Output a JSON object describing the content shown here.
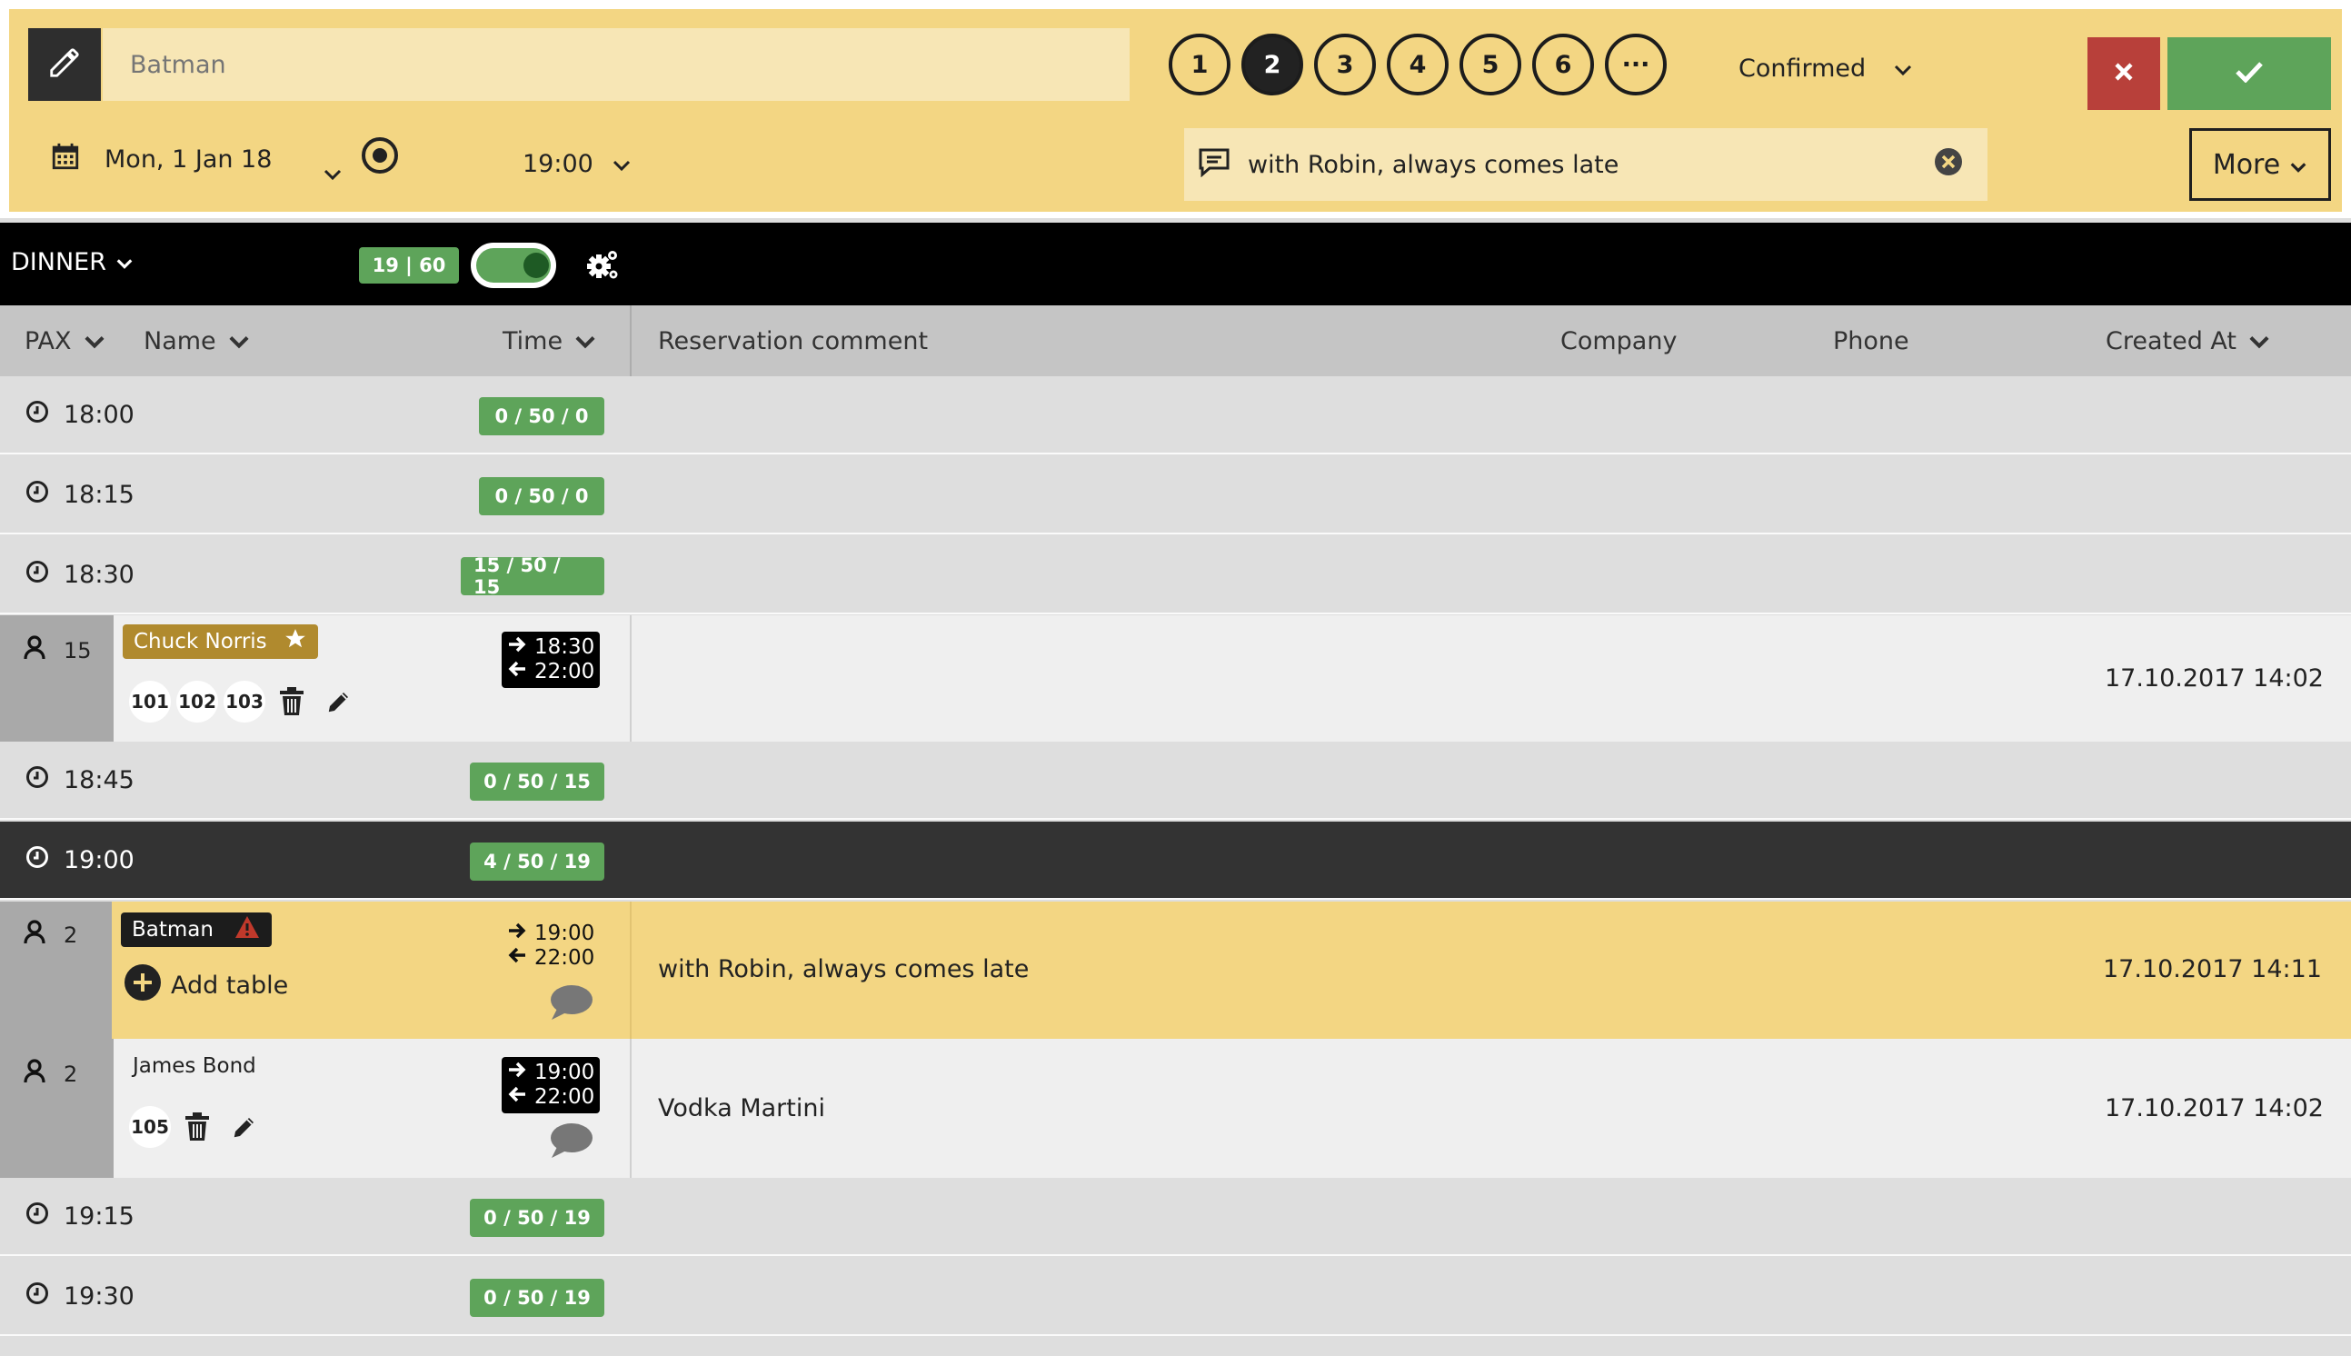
{
  "editor": {
    "name_placeholder": "Batman",
    "pax_options": [
      "1",
      "2",
      "3",
      "4",
      "5",
      "6",
      "···"
    ],
    "pax_selected": "2",
    "status": "Confirmed",
    "date": "Mon, 1 Jan 18",
    "time": "19:00",
    "comment": "with Robin, always comes late",
    "more_label": "More"
  },
  "service": {
    "name": "DINNER",
    "count": "19 | 60",
    "enabled": true
  },
  "columns": {
    "pax": "PAX",
    "name": "Name",
    "time": "Time",
    "comment": "Reservation comment",
    "company": "Company",
    "phone": "Phone",
    "created": "Created At"
  },
  "slots": [
    {
      "time": "18:00",
      "badge": "0 / 50 / 0"
    },
    {
      "time": "18:15",
      "badge": "0 / 50 / 0"
    },
    {
      "time": "18:30",
      "badge": "15 / 50 / 15"
    },
    {
      "time": "18:45",
      "badge": "0 / 50 / 15"
    },
    {
      "time": "19:00",
      "badge": "4 / 50 / 19"
    },
    {
      "time": "19:15",
      "badge": "0 / 50 / 19"
    },
    {
      "time": "19:30",
      "badge": "0 / 50 / 19"
    }
  ],
  "reservations": [
    {
      "pax": "15",
      "name": "Chuck Norris",
      "tables": [
        "101",
        "102",
        "103"
      ],
      "arrive": "18:30",
      "leave": "22:00",
      "comment": "",
      "created": "17.10.2017 14:02"
    },
    {
      "pax": "2",
      "name": "Batman",
      "add_table": "Add table",
      "arrive": "19:00",
      "leave": "22:00",
      "comment": "with Robin, always comes late",
      "created": "17.10.2017 14:11"
    },
    {
      "pax": "2",
      "name": "James Bond",
      "tables": [
        "105"
      ],
      "arrive": "19:00",
      "leave": "22:00",
      "comment": "Vodka Martini",
      "created": "17.10.2017 14:02"
    }
  ],
  "colors": {
    "accent_yellow": "#f3d683",
    "green": "#5ea45a",
    "red": "#b8403a",
    "vip_gold": "#b08a2e"
  }
}
